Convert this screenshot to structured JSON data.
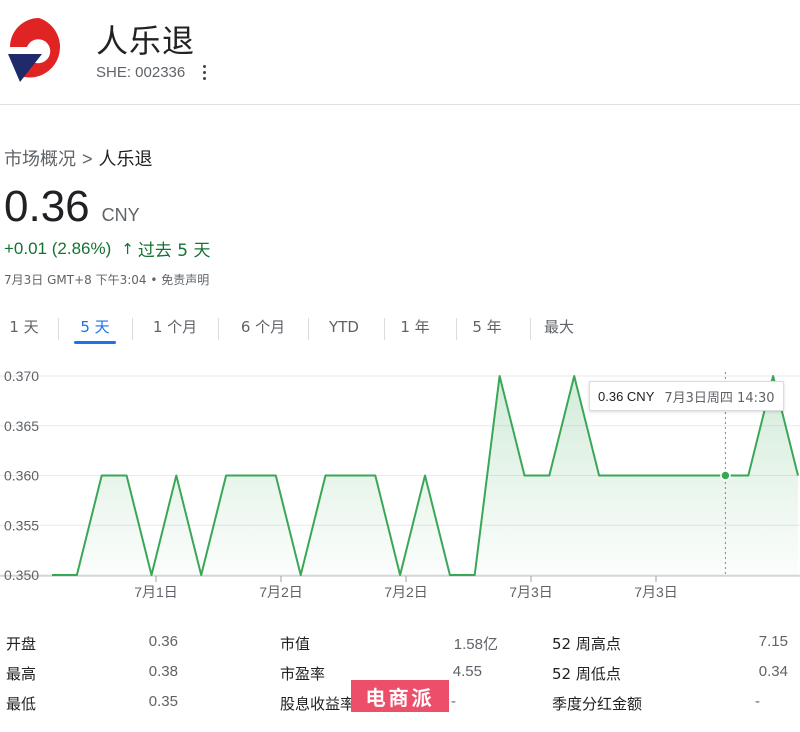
{
  "header": {
    "name": "人乐退",
    "ticker": "SHE: 002336"
  },
  "breadcrumb": {
    "root": "市场概况",
    "separator": ">",
    "current": "人乐退"
  },
  "quote": {
    "price": "0.36",
    "currency": "CNY",
    "change": "+0.01 (2.86%)",
    "arrow": "↑",
    "period": "过去 5 天",
    "timestamp": "7月3日 GMT+8 下午3:04 • 免责声明"
  },
  "tabs": [
    {
      "label": "1 天",
      "active": false
    },
    {
      "label": "5 天",
      "active": true
    },
    {
      "label": "1 个月",
      "active": false
    },
    {
      "label": "6 个月",
      "active": false
    },
    {
      "label": "YTD",
      "active": false
    },
    {
      "label": "1 年",
      "active": false
    },
    {
      "label": "5 年",
      "active": false
    },
    {
      "label": "最大",
      "active": false
    }
  ],
  "tooltip": {
    "price": "0.36 CNY",
    "date": "7月3日周四 14:30"
  },
  "stats": [
    {
      "label": "开盘",
      "value": "0.36"
    },
    {
      "label": "最高",
      "value": "0.38"
    },
    {
      "label": "最低",
      "value": "0.35"
    },
    {
      "label": "市值",
      "value": "1.58亿"
    },
    {
      "label": "市盈率",
      "value": "4.55"
    },
    {
      "label": "股息收益率",
      "value": "-"
    },
    {
      "label": "52 周高点",
      "value": "7.15"
    },
    {
      "label": "52 周低点",
      "value": "0.34"
    },
    {
      "label": "季度分红金额",
      "value": "-"
    }
  ],
  "watermark": "电商派",
  "colors": {
    "line": "#3aa757",
    "positive": "#137333",
    "accent": "#1a73e8",
    "logo_red": "#e02424",
    "logo_navy": "#1f2a6b",
    "watermark": "#ec4f6a"
  },
  "icons": {
    "more": "more-vert-icon",
    "arrow": "arrow-up-icon"
  },
  "chart_data": {
    "type": "line",
    "title": "",
    "xlabel": "",
    "ylabel": "",
    "ylim": [
      0.35,
      0.37
    ],
    "yticks": [
      "0.370",
      "0.365",
      "0.360",
      "0.355",
      "0.350"
    ],
    "yticks_values": [
      0.37,
      0.365,
      0.36,
      0.355,
      0.35
    ],
    "xticks": [
      "7月1日",
      "7月2日",
      "7月2日",
      "7月3日",
      "7月3日"
    ],
    "grid": true,
    "legend": "none",
    "series": [
      {
        "values": [
          0.35,
          0.35,
          0.36,
          0.36,
          0.35,
          0.36,
          0.35,
          0.36,
          0.36,
          0.36,
          0.35,
          0.36,
          0.36,
          0.36,
          0.35,
          0.36,
          0.35,
          0.35,
          0.37,
          0.36,
          0.36,
          0.37,
          0.36,
          0.36,
          0.36,
          0.36,
          0.36,
          0.36,
          0.36,
          0.37,
          0.36
        ]
      }
    ],
    "highlight": {
      "value": 0.36,
      "label": "0.36 CNY",
      "date": "7月3日周四 14:30"
    }
  }
}
